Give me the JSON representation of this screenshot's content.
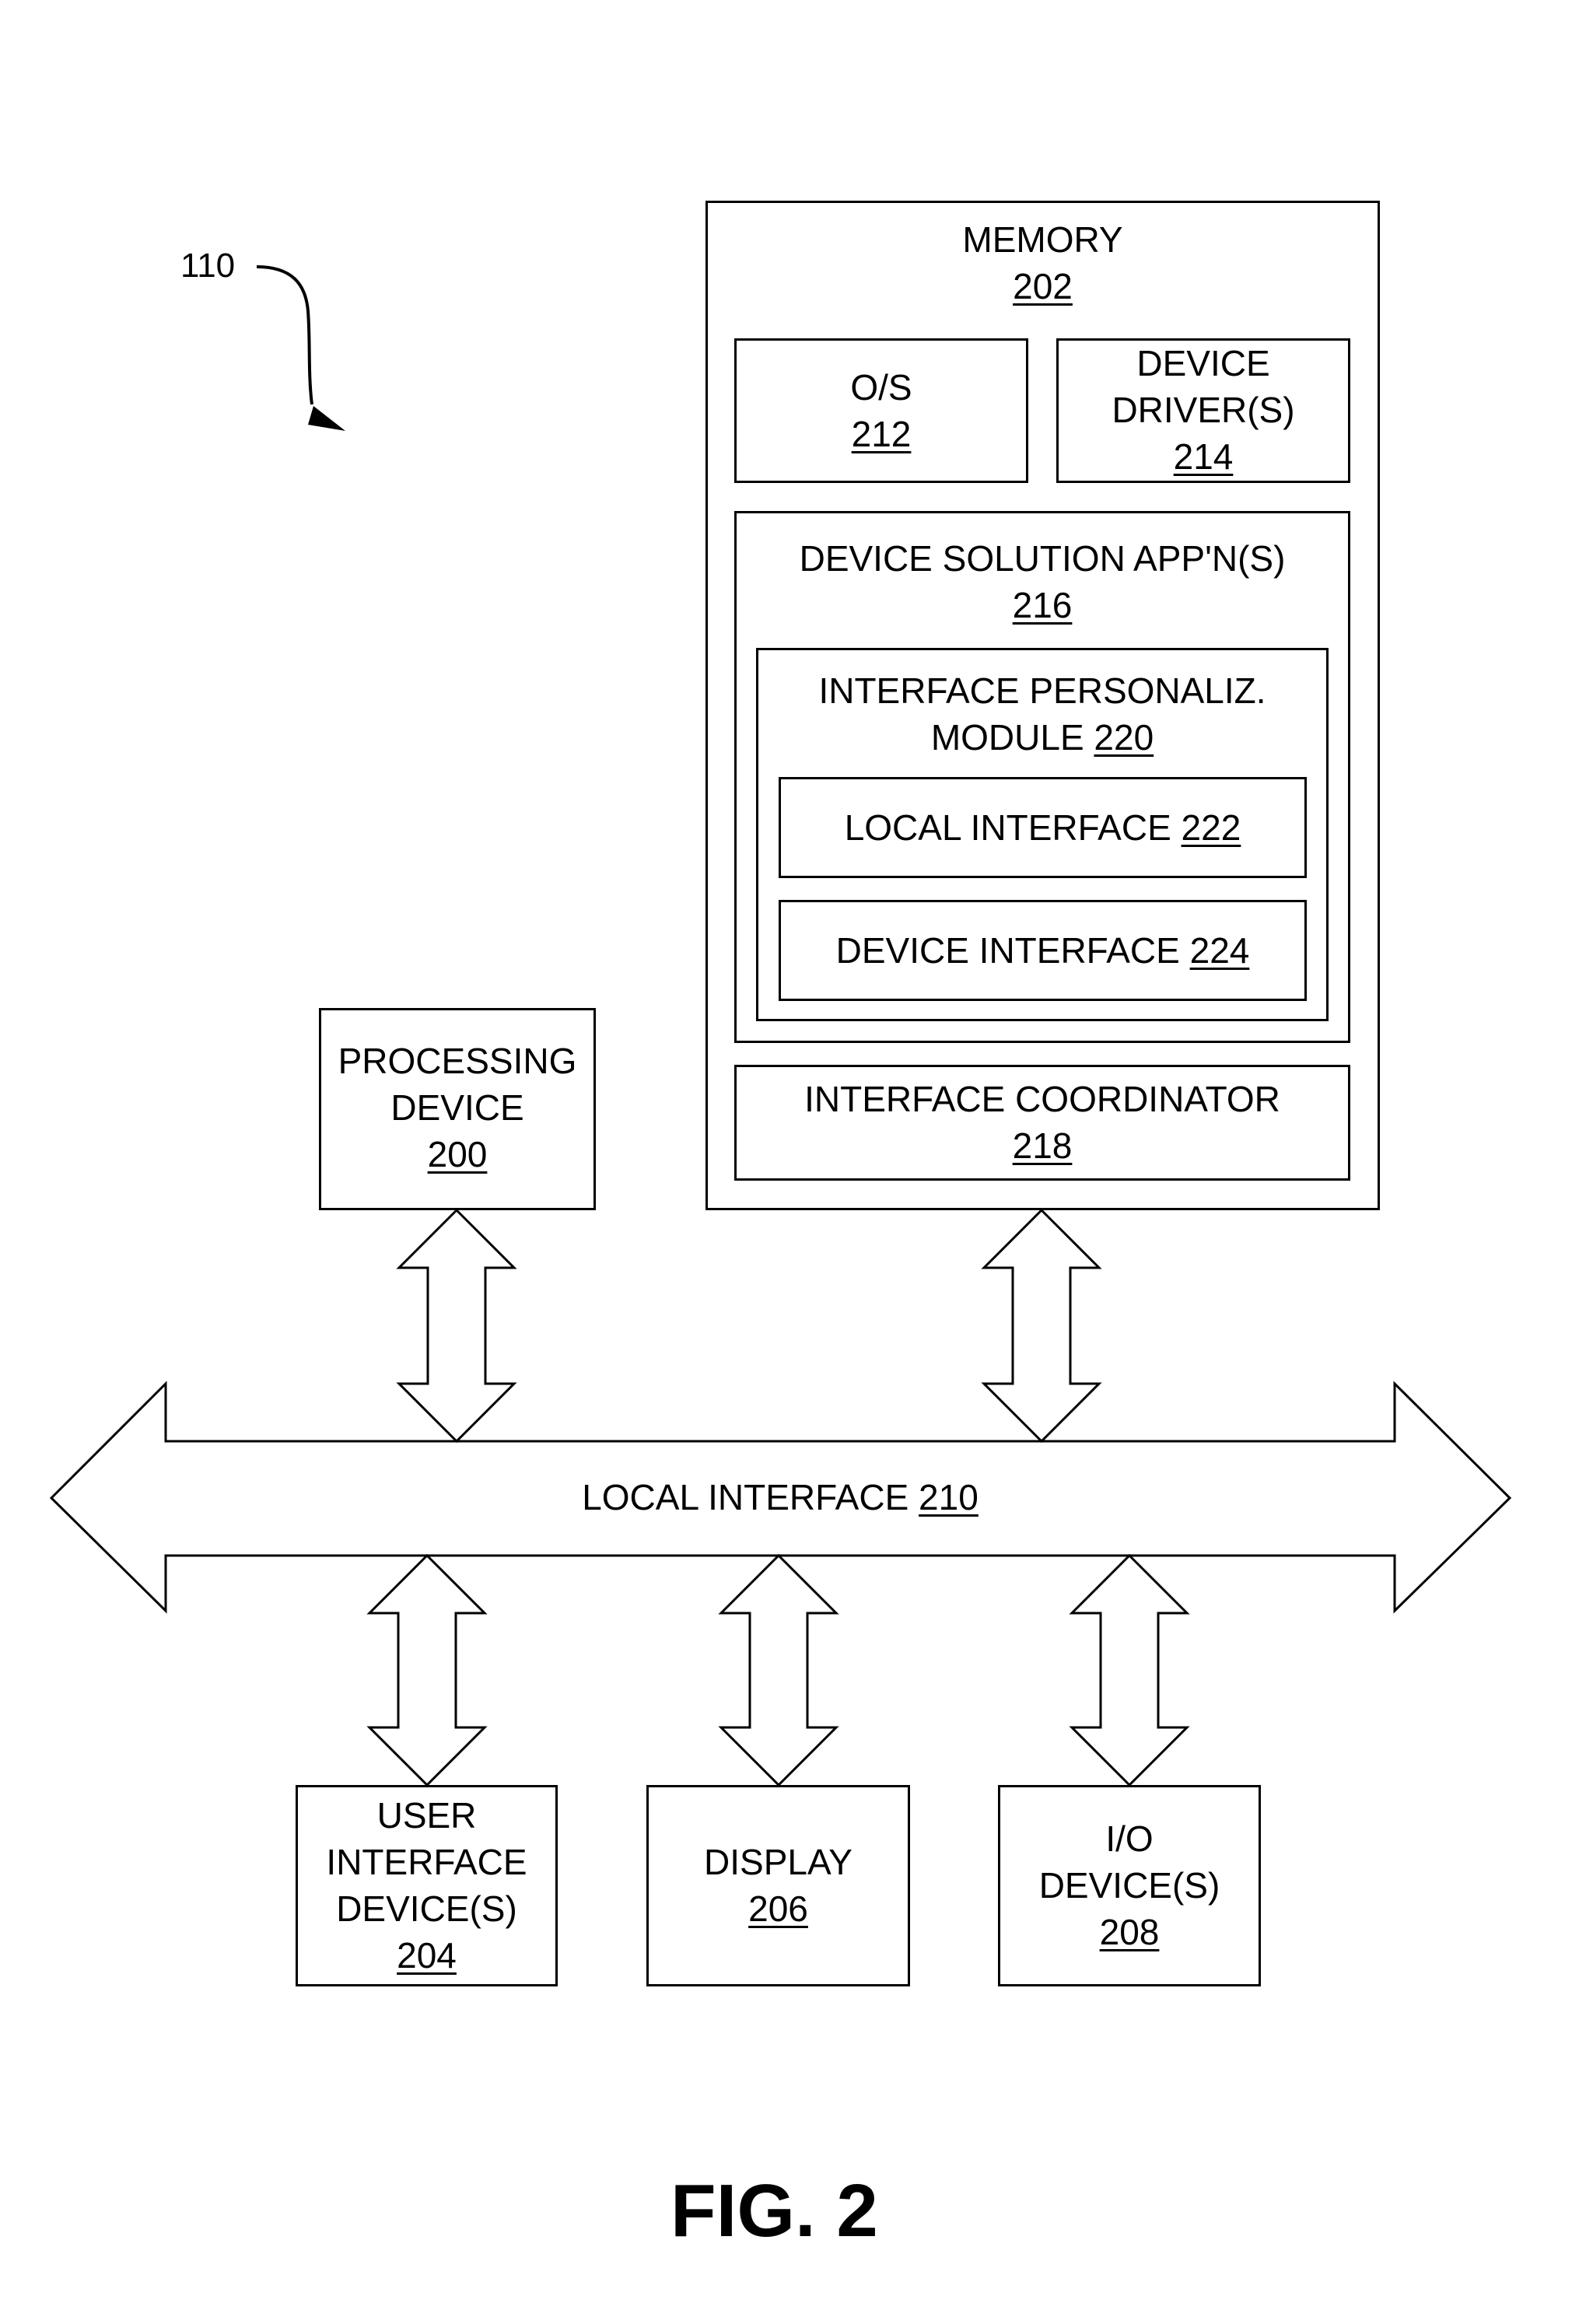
{
  "figure": {
    "title": "FIG. 2",
    "reference": "110"
  },
  "memory": {
    "label": "MEMORY",
    "ref": "202",
    "os": {
      "label": "O/S",
      "ref": "212"
    },
    "device_drivers": {
      "label_line1": "DEVICE",
      "label_line2": "DRIVER(S)",
      "ref": "214"
    },
    "device_solution_apps": {
      "label": "DEVICE SOLUTION APP'N(S)",
      "ref": "216",
      "interface_personalization_module": {
        "label_line1": "INTERFACE PERSONALIZ.",
        "label_line2": "MODULE",
        "ref": "220",
        "local_interface": {
          "label": "LOCAL INTERFACE",
          "ref": "222"
        },
        "device_interface": {
          "label": "DEVICE INTERFACE",
          "ref": "224"
        }
      }
    },
    "interface_coordinator": {
      "label": "INTERFACE COORDINATOR",
      "ref": "218"
    }
  },
  "processing_device": {
    "label_line1": "PROCESSING",
    "label_line2": "DEVICE",
    "ref": "200"
  },
  "local_interface_bus": {
    "label": "LOCAL INTERFACE",
    "ref": "210"
  },
  "user_interface_devices": {
    "label_line1": "USER",
    "label_line2": "INTERFACE",
    "label_line3": "DEVICE(S)",
    "ref": "204"
  },
  "display": {
    "label": "DISPLAY",
    "ref": "206"
  },
  "io_devices": {
    "label_line1": "I/O",
    "label_line2": "DEVICE(S)",
    "ref": "208"
  }
}
